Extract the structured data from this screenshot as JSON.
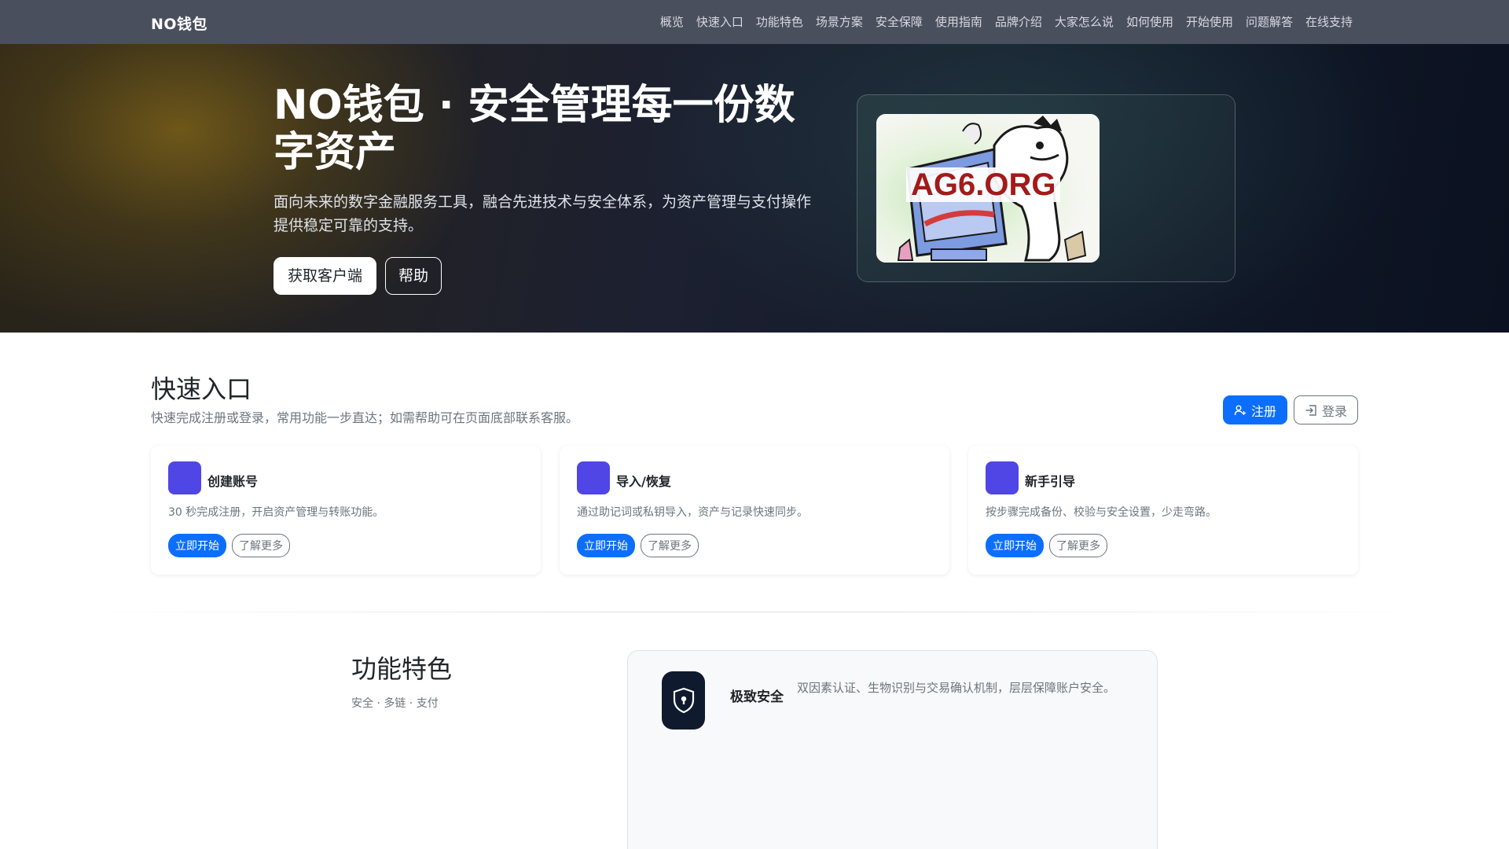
{
  "nav": {
    "brand": "NO钱包",
    "links": [
      "概览",
      "快速入口",
      "功能特色",
      "场景方案",
      "安全保障",
      "使用指南",
      "品牌介绍",
      "大家怎么说",
      "如何使用",
      "开始使用",
      "问题解答",
      "在线支持"
    ]
  },
  "hero": {
    "title": "NO钱包 · 安全管理每一份数字资产",
    "subtitle": "面向未来的数字金融服务工具，融合先进技术与安全体系，为资产管理与支付操作提供稳定可靠的支持。",
    "primary_button": "获取客户端",
    "secondary_button": "帮助",
    "image_text": "AG6.ORG"
  },
  "quick_entry": {
    "title": "快速入口",
    "subtitle": "快速完成注册或登录，常用功能一步直达；如需帮助可在页面底部联系客服。",
    "register_button": "注册",
    "login_button": "登录",
    "cards": [
      {
        "title": "创建账号",
        "desc": "30 秒完成注册，开启资产管理与转账功能。",
        "primary": "立即开始",
        "secondary": "了解更多"
      },
      {
        "title": "导入/恢复",
        "desc": "通过助记词或私钥导入，资产与记录快速同步。",
        "primary": "立即开始",
        "secondary": "了解更多"
      },
      {
        "title": "新手引导",
        "desc": "按步骤完成备份、校验与安全设置，少走弯路。",
        "primary": "立即开始",
        "secondary": "了解更多"
      }
    ]
  },
  "features": {
    "title": "功能特色",
    "subtitle": "安全 · 多链 · 支付",
    "items": [
      {
        "name": "极致安全",
        "desc": "双因素认证、生物识别与交易确认机制，层层保障账户安全。"
      }
    ]
  },
  "colors": {
    "primary": "#0d6efd",
    "card_icon": "#4f46e5",
    "navbar": "#4a4f5e",
    "feature_icon": "#0f1a2e"
  },
  "icons": {
    "register": "person-add-icon",
    "login": "box-arrow-in-icon",
    "feature": "shield-lock-icon"
  }
}
